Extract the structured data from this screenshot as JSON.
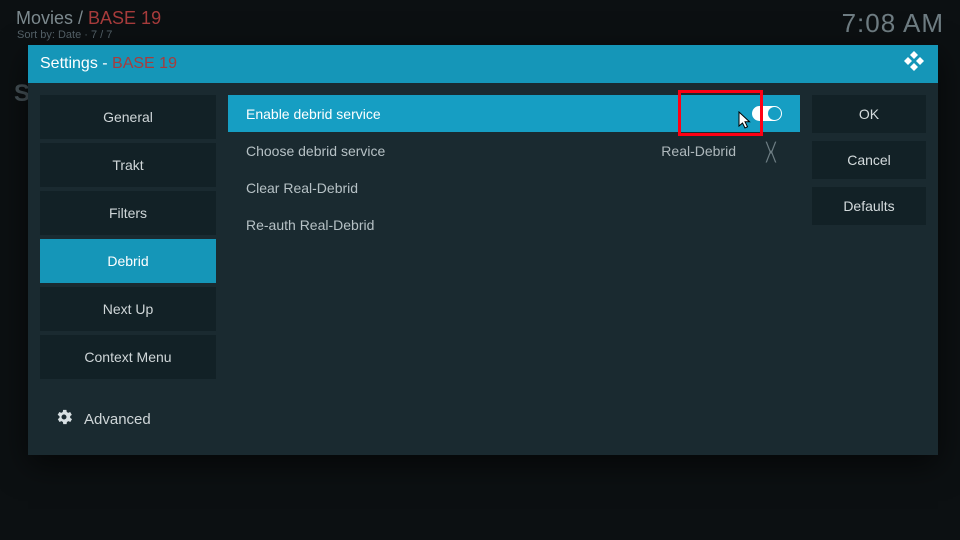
{
  "header": {
    "breadcrumb_prefix": "Movies / ",
    "breadcrumb_addon": "BASE 19",
    "sort_line": "Sort by: Date  ·  7 / 7",
    "clock": "7:08 AM",
    "bg_letter": "S"
  },
  "dialog": {
    "title_prefix": "Settings - ",
    "title_addon": "BASE 19"
  },
  "sidebar": {
    "items": [
      {
        "label": "General"
      },
      {
        "label": "Trakt"
      },
      {
        "label": "Filters"
      },
      {
        "label": "Debrid"
      },
      {
        "label": "Next Up"
      },
      {
        "label": "Context Menu"
      }
    ],
    "advanced": "Advanced"
  },
  "settings": {
    "rows": [
      {
        "label": "Enable debrid service",
        "type": "toggle",
        "value": "on"
      },
      {
        "label": "Choose debrid service",
        "type": "spinner",
        "value": "Real-Debrid"
      },
      {
        "label": "Clear Real-Debrid",
        "type": "action"
      },
      {
        "label": "Re-auth Real-Debrid",
        "type": "action"
      }
    ]
  },
  "buttons": {
    "ok": "OK",
    "cancel": "Cancel",
    "defaults": "Defaults"
  }
}
